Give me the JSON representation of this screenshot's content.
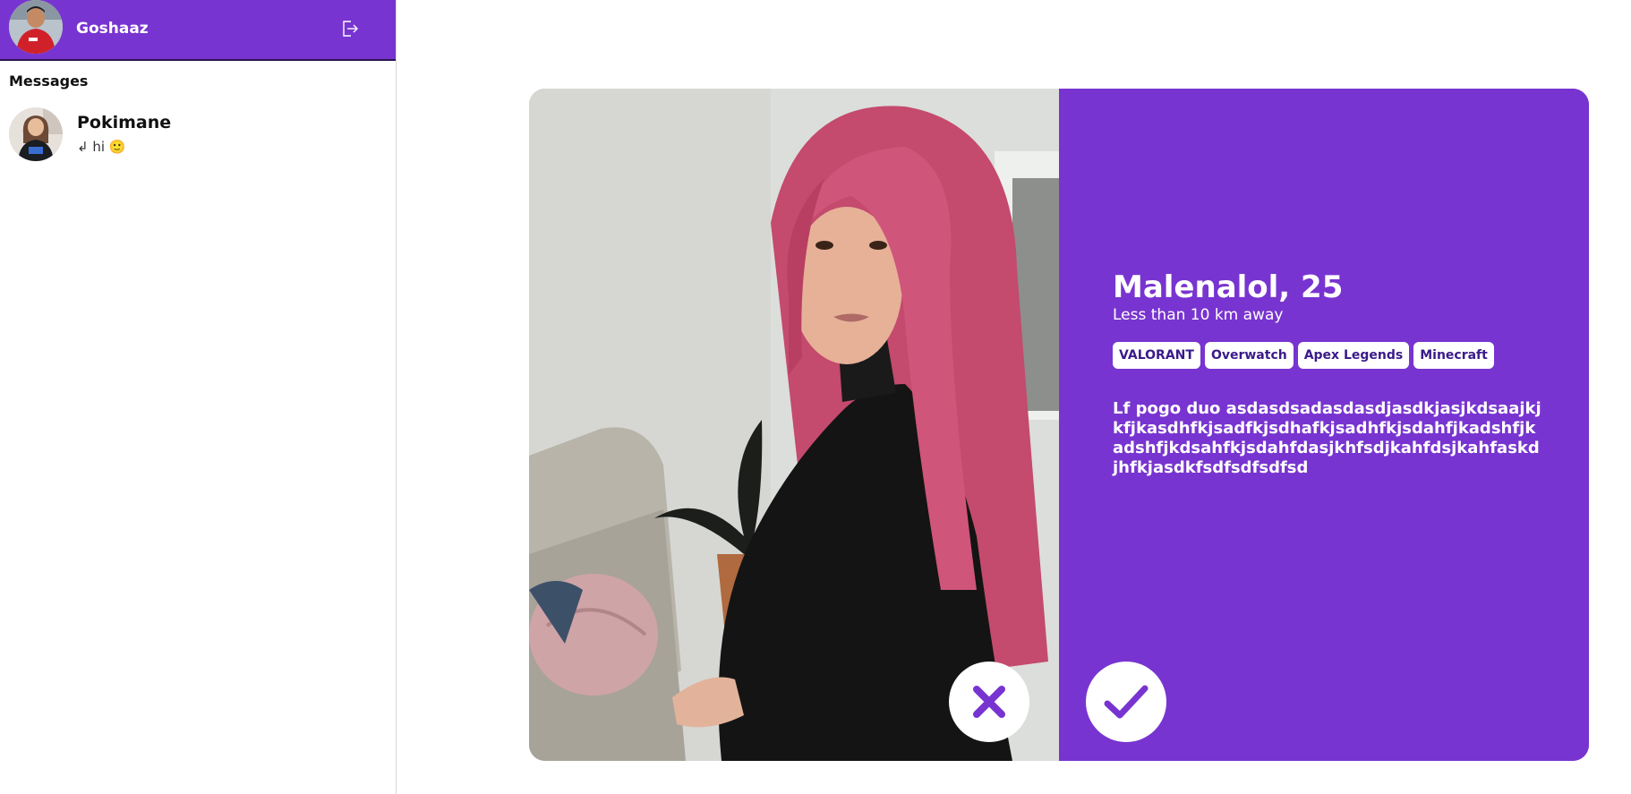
{
  "header": {
    "username": "Goshaaz",
    "logout_icon": "logout-icon"
  },
  "sidebar": {
    "messages_title": "Messages",
    "conversations": [
      {
        "name": "Pokimane",
        "preview": "↲ hi 🙂"
      }
    ]
  },
  "profile": {
    "name_age": "Malenalol, 25",
    "distance": "Less than 10 km away",
    "games": [
      "VALORANT",
      "Overwatch",
      "Apex Legends",
      "Minecraft"
    ],
    "bio": "Lf pogo duo asdasdsadasdasdjasdkjasjkdsaajkjkfjkasdhfkjsadfkjsdhafkjsadhfkjsdahfjkadshfjkadshfjkdsahfkjsdahfdasjkhfsdjkahfdsjkahfaskdjhfkjasdkfsdfsdfsdfsd"
  },
  "actions": {
    "reject_icon": "close-icon",
    "accept_icon": "check-icon"
  },
  "colors": {
    "accent": "#7834d0",
    "tag_text": "#3a1a8a",
    "white": "#ffffff"
  }
}
